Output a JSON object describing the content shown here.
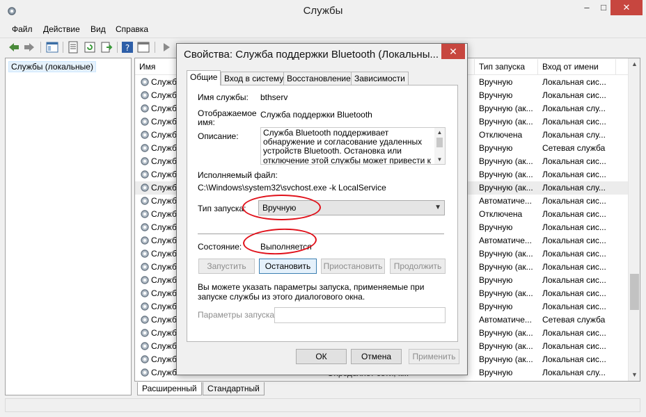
{
  "window": {
    "title": "Службы",
    "controls": {
      "minimize": "–",
      "maximize": "□",
      "close": "✕"
    }
  },
  "menu": [
    "Файл",
    "Действие",
    "Вид",
    "Справка"
  ],
  "tree": {
    "root_label": "Службы (локальные)"
  },
  "list": {
    "columns": [
      "Имя",
      "Тип запуска",
      "Вход от имени"
    ],
    "rows": [
      {
        "name": "Служба",
        "startup": "Вручную",
        "logon": "Локальная сис..."
      },
      {
        "name": "Служба",
        "startup": "Вручную",
        "logon": "Локальная сис..."
      },
      {
        "name": "Служба",
        "startup": "Вручную (ак...",
        "logon": "Локальная слу..."
      },
      {
        "name": "Служба",
        "startup": "Вручную (ак...",
        "logon": "Локальная сис..."
      },
      {
        "name": "Служба",
        "startup": "Отключена",
        "logon": "Локальная слу..."
      },
      {
        "name": "Служба",
        "startup": "Вручную",
        "logon": "Сетевая служба"
      },
      {
        "name": "Служба",
        "startup": "Вручную (ак...",
        "logon": "Локальная сис..."
      },
      {
        "name": "Служба",
        "startup": "Вручную (ак...",
        "logon": "Локальная сис..."
      },
      {
        "name": "Служба",
        "startup": "Вручную (ак...",
        "logon": "Локальная слу..."
      },
      {
        "name": "Служба",
        "startup": "Автоматиче...",
        "logon": "Локальная сис..."
      },
      {
        "name": "Служба",
        "startup": "Отключена",
        "logon": "Локальная сис..."
      },
      {
        "name": "Служба",
        "startup": "Вручную",
        "logon": "Локальная сис..."
      },
      {
        "name": "Служба",
        "startup": "Автоматиче...",
        "logon": "Локальная сис..."
      },
      {
        "name": "Служба",
        "startup": "Вручную (ак...",
        "logon": "Локальная сис..."
      },
      {
        "name": "Служба",
        "startup": "Вручную (ак...",
        "logon": "Локальная сис..."
      },
      {
        "name": "Служба",
        "startup": "Вручную",
        "logon": "Локальная сис..."
      },
      {
        "name": "Служба",
        "startup": "Вручную (ак...",
        "logon": "Локальная сис..."
      },
      {
        "name": "Служба",
        "startup": "Вручную",
        "logon": "Локальная сис..."
      },
      {
        "name": "Служба",
        "startup": "Автоматиче...",
        "logon": "Сетевая служба"
      },
      {
        "name": "Служба",
        "startup": "Вручную (ак...",
        "logon": "Локальная сис..."
      },
      {
        "name": "Служба",
        "startup": "Вручную (ак...",
        "logon": "Локальная сис..."
      },
      {
        "name": "Служба",
        "startup": "Вручную (ак...",
        "logon": "Локальная сис..."
      },
      {
        "name": "Служба списка сетей",
        "startup": "Вручную",
        "logon": "Локальная слу..."
      }
    ],
    "hidden_fragment": "Определяет сети, к...",
    "selected_row": 8
  },
  "bottom_tabs": [
    "Расширенный",
    "Стандартный"
  ],
  "dialog": {
    "title": "Свойства: Служба поддержки Bluetooth (Локальны...",
    "close": "✕",
    "tabs": [
      "Общие",
      "Вход в систему",
      "Восстановление",
      "Зависимости"
    ],
    "active_tab": 0,
    "service_name_label": "Имя службы:",
    "service_name": "bthserv",
    "display_name_label": "Отображаемое имя:",
    "display_name": "Служба поддержки Bluetooth",
    "description_label": "Описание:",
    "description": "Служба Bluetooth поддерживает обнаружение и согласование удаленных устройств Bluetooth. Остановка или отключение этой службы может привести к сбоям в работе уже установленных",
    "exe_label": "Исполняемый файл:",
    "exe_path": "C:\\Windows\\system32\\svchost.exe -k LocalService",
    "startup_label": "Тип запуска:",
    "startup_value": "Вручную",
    "status_label": "Состояние:",
    "status_value": "Выполняется",
    "buttons": {
      "start": "Запустить",
      "stop": "Остановить",
      "pause": "Приостановить",
      "resume": "Продолжить"
    },
    "hint": "Вы можете указать параметры запуска, применяемые при запуске службы из этого диалогового окна.",
    "params_label": "Параметры запуска:",
    "params_value": "",
    "ok": "ОК",
    "cancel": "Отмена",
    "apply": "Применить"
  },
  "colors": {
    "accent_close": "#c7463f",
    "annotation": "#e0101a",
    "selection": "#ececec"
  },
  "icons": [
    "services-gear-icon",
    "back-arrow-icon",
    "forward-arrow-icon",
    "console-tree-icon",
    "properties-icon",
    "refresh-icon",
    "export-icon",
    "help-icon",
    "view-icon",
    "play-icon"
  ]
}
